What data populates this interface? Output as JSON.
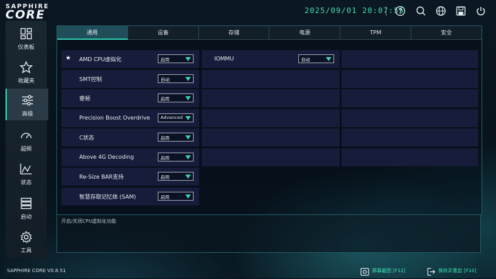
{
  "brand": {
    "line1": "SAPPHIRE",
    "line2": "CORE"
  },
  "header": {
    "datetime": "2025/09/01 20:07:55"
  },
  "header_icons": [
    "help-icon",
    "search-icon",
    "globe-icon",
    "save-icon",
    "power-icon"
  ],
  "sidebar": {
    "items": [
      {
        "label": "仪表板",
        "icon": "dashboard-icon",
        "active": false
      },
      {
        "label": "收藏夹",
        "icon": "star-icon",
        "active": false
      },
      {
        "label": "高级",
        "icon": "sliders-icon",
        "active": true
      },
      {
        "label": "超频",
        "icon": "gauge-icon",
        "active": false
      },
      {
        "label": "状态",
        "icon": "chart-icon",
        "active": false
      },
      {
        "label": "启动",
        "icon": "boot-icon",
        "active": false
      },
      {
        "label": "工具",
        "icon": "gear-icon",
        "active": false
      }
    ]
  },
  "tabs": [
    {
      "label": "通用",
      "active": true
    },
    {
      "label": "设备",
      "active": false
    },
    {
      "label": "存储",
      "active": false
    },
    {
      "label": "电源",
      "active": false
    },
    {
      "label": "TPM",
      "active": false
    },
    {
      "label": "安全",
      "active": false
    }
  ],
  "settings_col1": [
    {
      "label": "AMD CPU虚拟化",
      "value": "启用",
      "starred": true
    },
    {
      "label": "SMT控制",
      "value": "自动",
      "starred": false
    },
    {
      "label": "睿频",
      "value": "启用",
      "starred": false
    },
    {
      "label": "Precision Boost Overdrive",
      "value": "Advanced",
      "starred": false
    },
    {
      "label": "C状态",
      "value": "启用",
      "starred": false
    },
    {
      "label": "Above 4G Decoding",
      "value": "启用",
      "starred": false
    },
    {
      "label": "Re-Size BAR支持",
      "value": "启用",
      "starred": false
    },
    {
      "label": "智慧存取记忆体 (SAM)",
      "value": "启用",
      "starred": false
    }
  ],
  "settings_col2": [
    {
      "label": "IOMMU",
      "value": "自动",
      "starred": false
    }
  ],
  "help": {
    "text": "开启/关闭CPU虚拟化功能"
  },
  "footer": {
    "version": "SAPPHIRE CORE V0.8.51",
    "screenshot_label": "屏幕截图 [F12]",
    "save_label": "保存并重启 [F10]"
  },
  "colors": {
    "accent": "#3fe0b4",
    "row_bg": "#161c3a",
    "border": "#245a66"
  }
}
